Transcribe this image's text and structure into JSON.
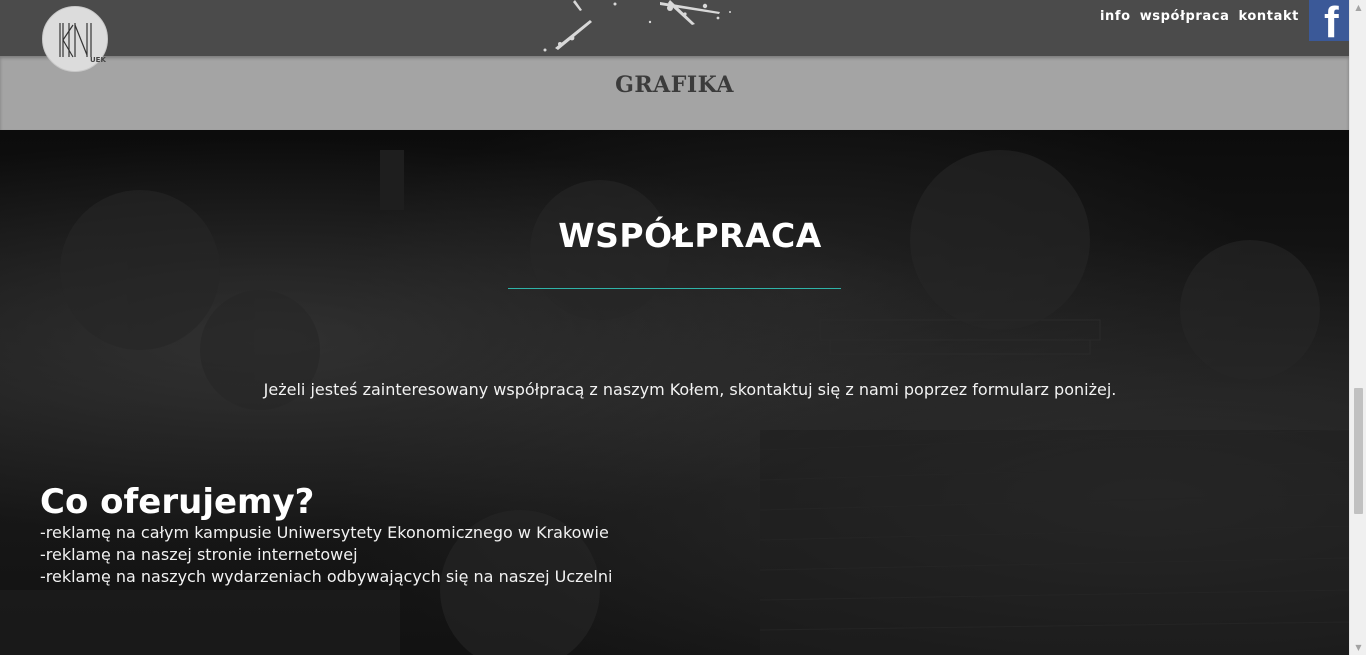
{
  "header": {
    "logo_sub": "UEK",
    "nav": [
      "info",
      "współpraca",
      "kontakt"
    ],
    "facebook_glyph": "f",
    "facebook_icon": "facebook-icon"
  },
  "grafika": {
    "title": "GRAFIKA"
  },
  "wspolpraca": {
    "title": "WSPÓŁPRACA",
    "intro": "Jeżeli jesteś zainteresowany współpracą z naszym Kołem, skontaktuj się z nami poprzez formularz poniżej.",
    "offer_title": "Co oferujemy?",
    "offers": [
      "-reklamę na całym kampusie Uniwersytety Ekonomicznego w Krakowie",
      "-reklamę na naszej stronie internetowej",
      "-reklamę na naszych wydarzeniach odbywających się na naszej Uczelni"
    ]
  },
  "colors": {
    "accent_line": "#2fb3a8",
    "facebook_blue": "#3b5998",
    "top_banner": "#4b4b4b",
    "grafika_band": "#a4a4a4"
  }
}
